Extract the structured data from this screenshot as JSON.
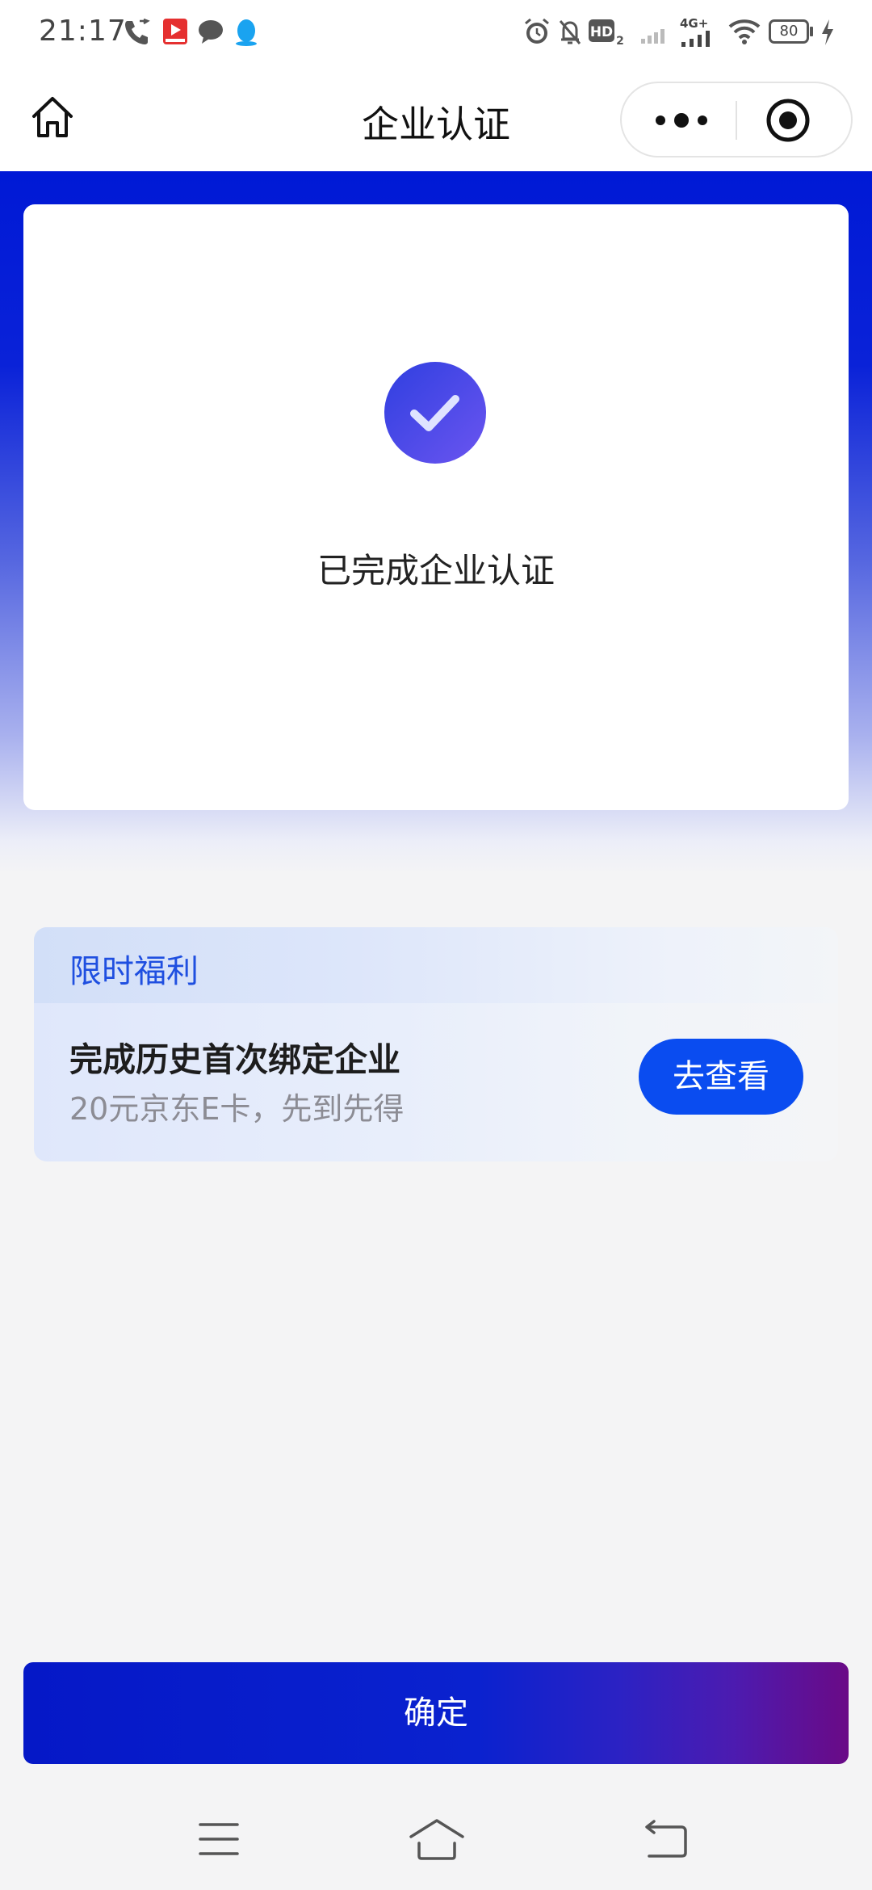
{
  "status_bar": {
    "time": "21:17",
    "network": "4G+",
    "battery": "80",
    "left_icons": [
      "phone-icon",
      "video-app-icon",
      "chat-bubble-icon",
      "qq-penguin-icon"
    ],
    "right_icons": [
      "alarm-icon",
      "mute-bell-icon",
      "hd-icon",
      "signal-icon",
      "wifi-icon",
      "battery-icon",
      "charging-icon"
    ]
  },
  "nav": {
    "title": "企业认证",
    "icons": [
      "home-icon",
      "more-dots-icon",
      "close-target-icon"
    ]
  },
  "success": {
    "message": "已完成企业认证",
    "icon": "check-icon",
    "colors": {
      "badge_start": "#2f3fe0",
      "badge_end": "#6b55f0"
    }
  },
  "promo": {
    "tag": "限时福利",
    "title": "完成历史首次绑定企业",
    "subtitle": "20元京东E卡，先到先得",
    "button_label": "去查看",
    "button_color": "#0a4cf0"
  },
  "confirm": {
    "label": "确定"
  },
  "system_nav": {
    "icons": [
      "menu-icon",
      "home-icon",
      "back-icon"
    ]
  },
  "colors": {
    "hero": "#0019d6",
    "page_bg": "#f4f4f5",
    "accent": "#1f4fe0"
  }
}
